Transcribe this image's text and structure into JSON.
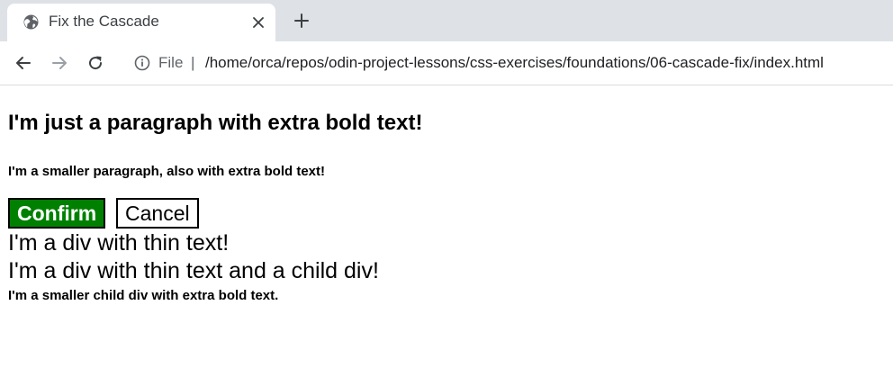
{
  "browser": {
    "tab": {
      "title": "Fix the Cascade",
      "favicon": "globe-icon",
      "close": "close-icon"
    },
    "new_tab": "plus-icon",
    "nav": {
      "back": "arrow-left-icon",
      "forward": "arrow-right-icon",
      "reload": "reload-icon"
    },
    "address_bar": {
      "info_icon": "info-icon",
      "scheme_label": "File",
      "separator": "|",
      "url": "/home/orca/repos/odin-project-lessons/css-exercises/foundations/06-cascade-fix/index.html"
    }
  },
  "page": {
    "para_bold": "I'm just a paragraph with extra bold text!",
    "para_small": "I'm a smaller paragraph, also with extra bold text!",
    "confirm_label": "Confirm",
    "cancel_label": "Cancel",
    "div_thin": "I'm a div with thin text!",
    "div_thin_parent": "I'm a div with thin text and a child div!",
    "div_child": "I'm a smaller child div with extra bold text."
  },
  "colors": {
    "confirm_bg": "#008000",
    "confirm_text": "#ffffff",
    "tabstrip_bg": "#dee1e6"
  }
}
